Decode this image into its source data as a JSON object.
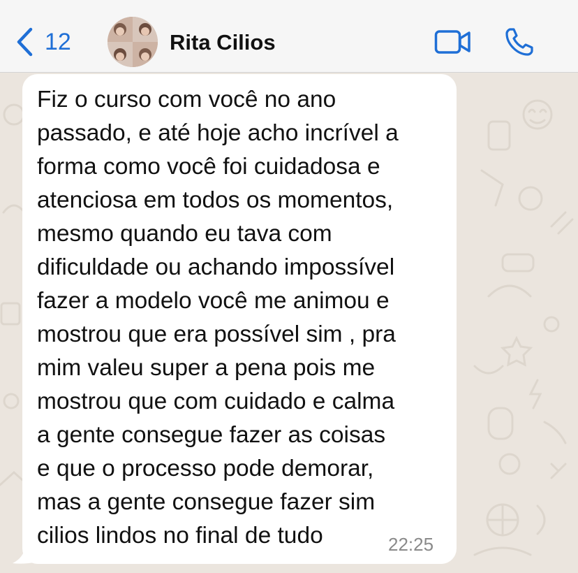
{
  "header": {
    "back_count": "12",
    "contact_name": "Rita Cilios",
    "icons": {
      "back": "chevron-left-icon",
      "video": "video-call-icon",
      "call": "phone-icon"
    },
    "accent_color": "#1f6fd6"
  },
  "message": {
    "lines": [
      "Fiz o curso com você no ano",
      "passado, e até hoje acho incrível a",
      "forma como você foi cuidadosa e",
      "atenciosa em todos os momentos,",
      "mesmo quando eu tava com",
      "dificuldade ou achando impossível",
      "fazer a modelo você me animou e",
      "mostrou que era possível sim , pra",
      "mim valeu super a pena pois me",
      "mostrou que com cuidado e calma",
      "a gente consegue fazer as coisas",
      "e que o processo pode demorar,",
      "mas a gente consegue fazer sim",
      "cilios lindos no final de tudo"
    ],
    "time": "22:25"
  }
}
